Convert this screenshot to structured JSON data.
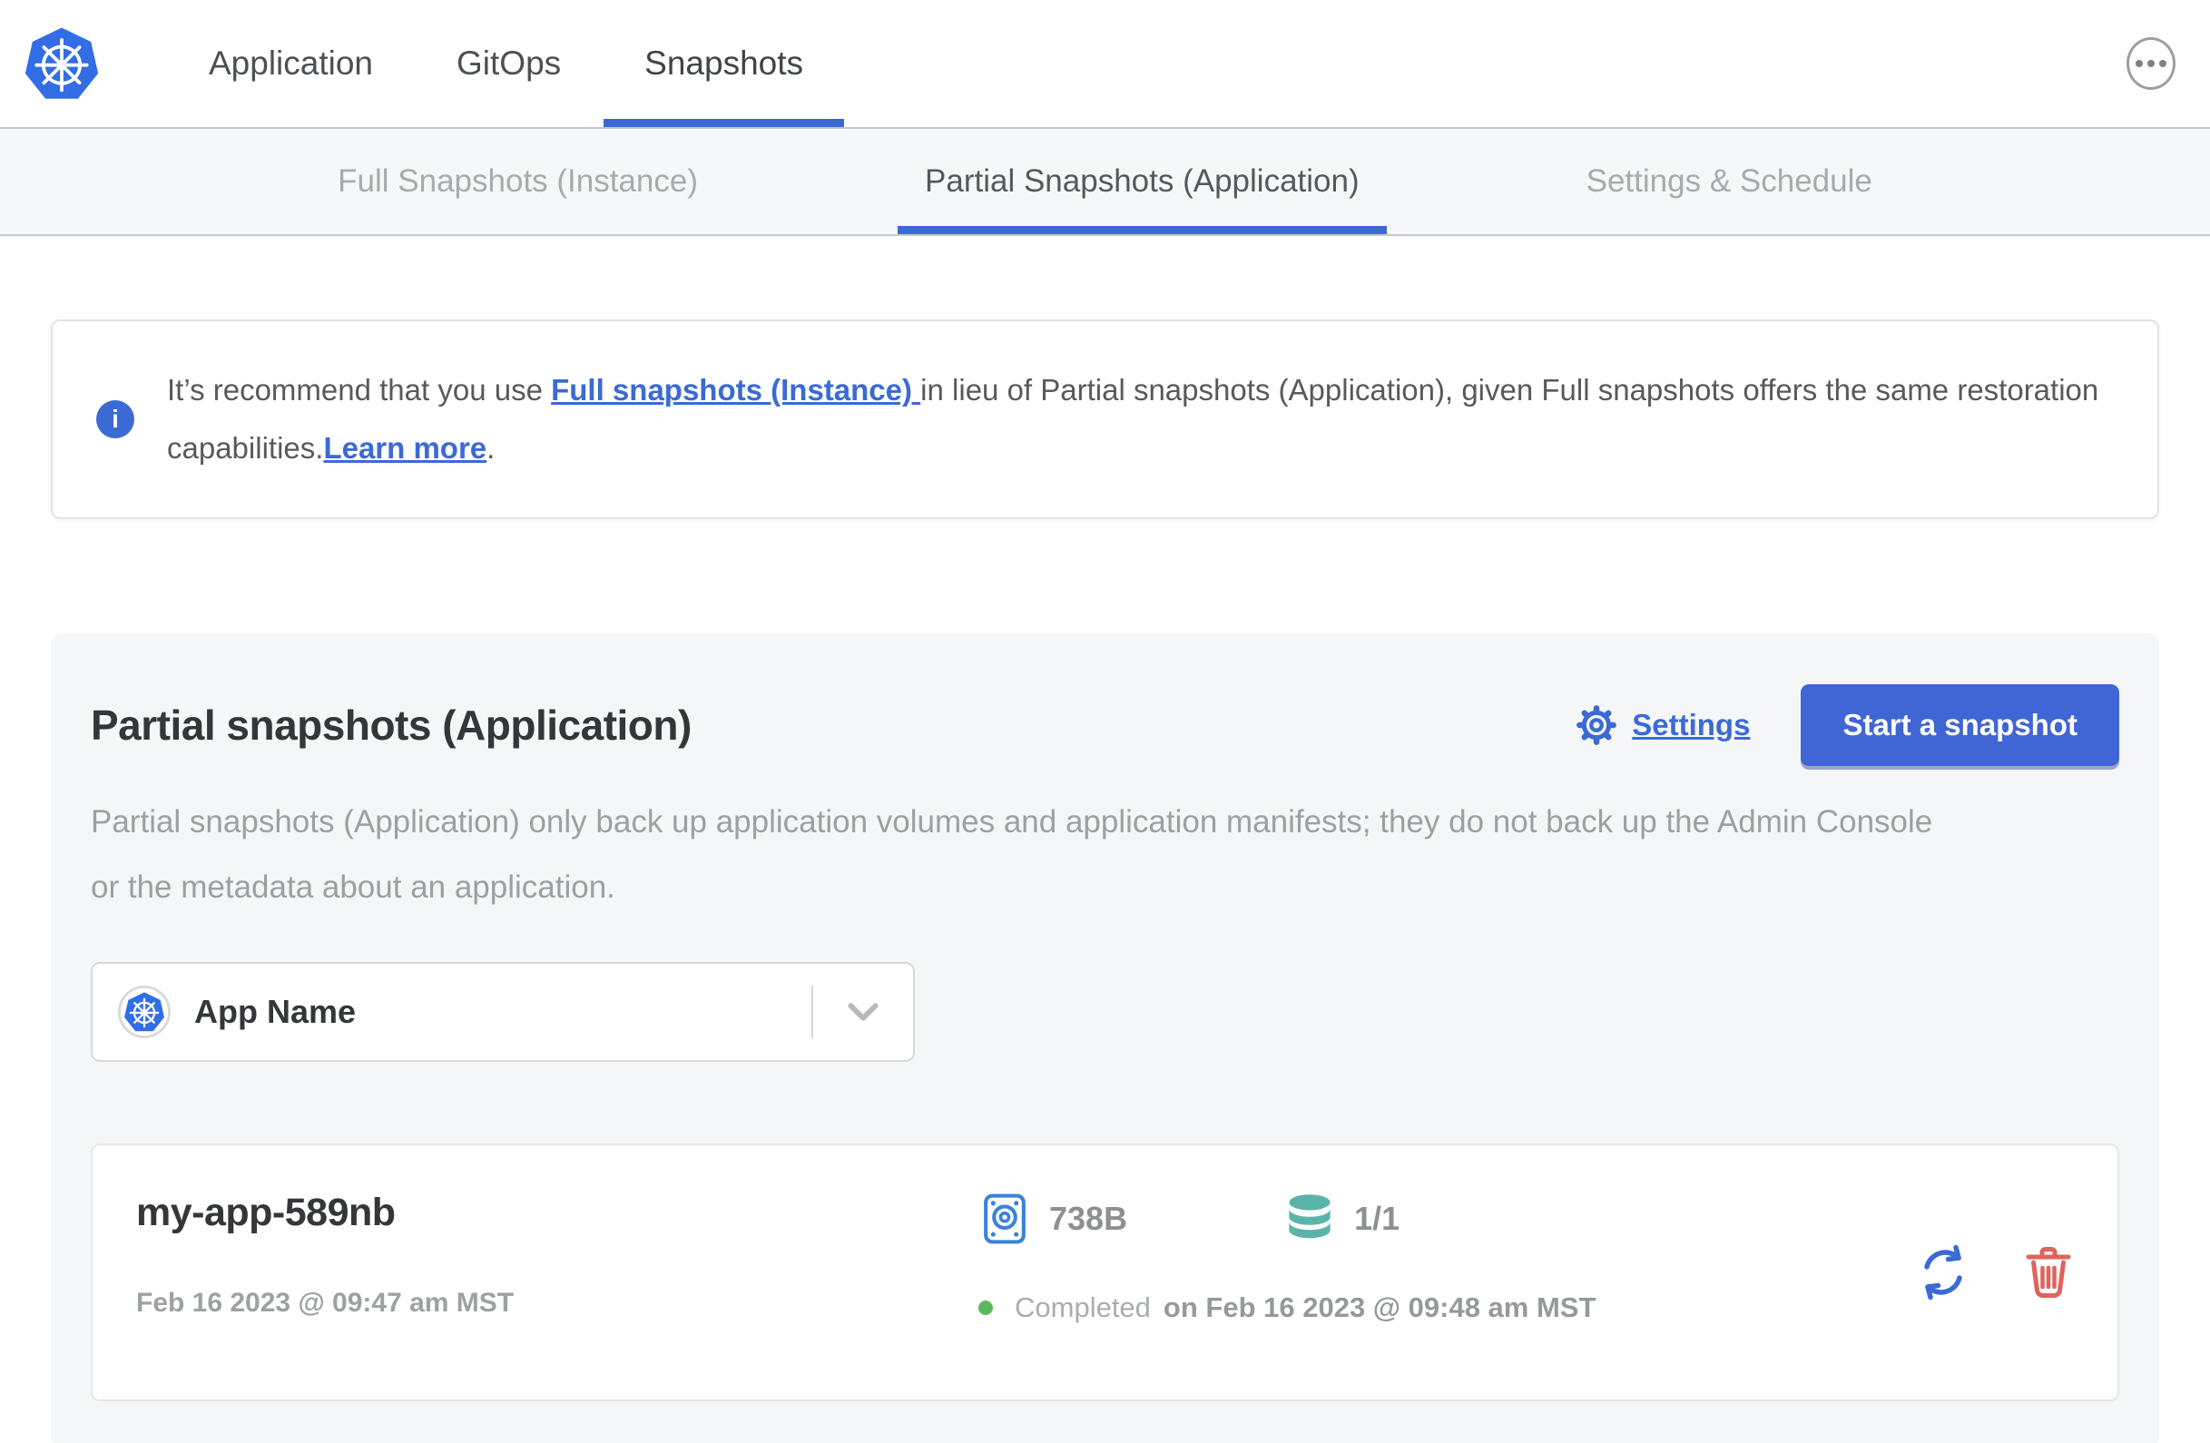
{
  "header": {
    "logo_icon": "kubernetes-logo",
    "nav": [
      {
        "label": "Application",
        "active": false
      },
      {
        "label": "GitOps",
        "active": false
      },
      {
        "label": "Snapshots",
        "active": true
      }
    ],
    "menu_icon": "ellipsis"
  },
  "subnav": {
    "tabs": [
      {
        "label": "Full Snapshots (Instance)",
        "active": false
      },
      {
        "label": "Partial Snapshots (Application)",
        "active": true
      },
      {
        "label": "Settings & Schedule",
        "active": false
      }
    ]
  },
  "banner": {
    "icon": "info",
    "text_before": "It’s recommend that you use ",
    "link_full_snapshots": "Full snapshots (Instance) ",
    "text_middle": "in lieu of Partial snapshots (Application), given Full snapshots offers the same restoration capabilities.",
    "link_learn_more": "Learn more",
    "text_after": "."
  },
  "main": {
    "title": "Partial snapshots (Application)",
    "settings_icon": "gear",
    "settings_label": "Settings",
    "start_button_label": "Start a snapshot",
    "description": "Partial snapshots (Application) only back up application volumes and application manifests; they do not back up the Admin Console or the metadata about an application.",
    "app_selector": {
      "icon": "kubernetes",
      "value": "App Name",
      "chevron_icon": "chevron-down"
    },
    "snapshots": [
      {
        "name": "my-app-589nb",
        "started": "Feb 16 2023 @ 09:47 am MST",
        "size_icon": "disk",
        "size": "738B",
        "volumes_icon": "database",
        "volumes": "1/1",
        "status_dot": "green-dot",
        "status": "Completed",
        "finished": "on Feb 16 2023 @ 09:48 am MST",
        "restore_icon": "restore-arrows",
        "delete_icon": "trash"
      }
    ]
  },
  "colors": {
    "accent_blue": "#3b6ad5",
    "kubernetes_blue": "#326de6",
    "disk_blue": "#3b82d8",
    "teal": "#5bb4aa",
    "danger_red": "#e0635e",
    "success_green": "#5cb85f"
  }
}
